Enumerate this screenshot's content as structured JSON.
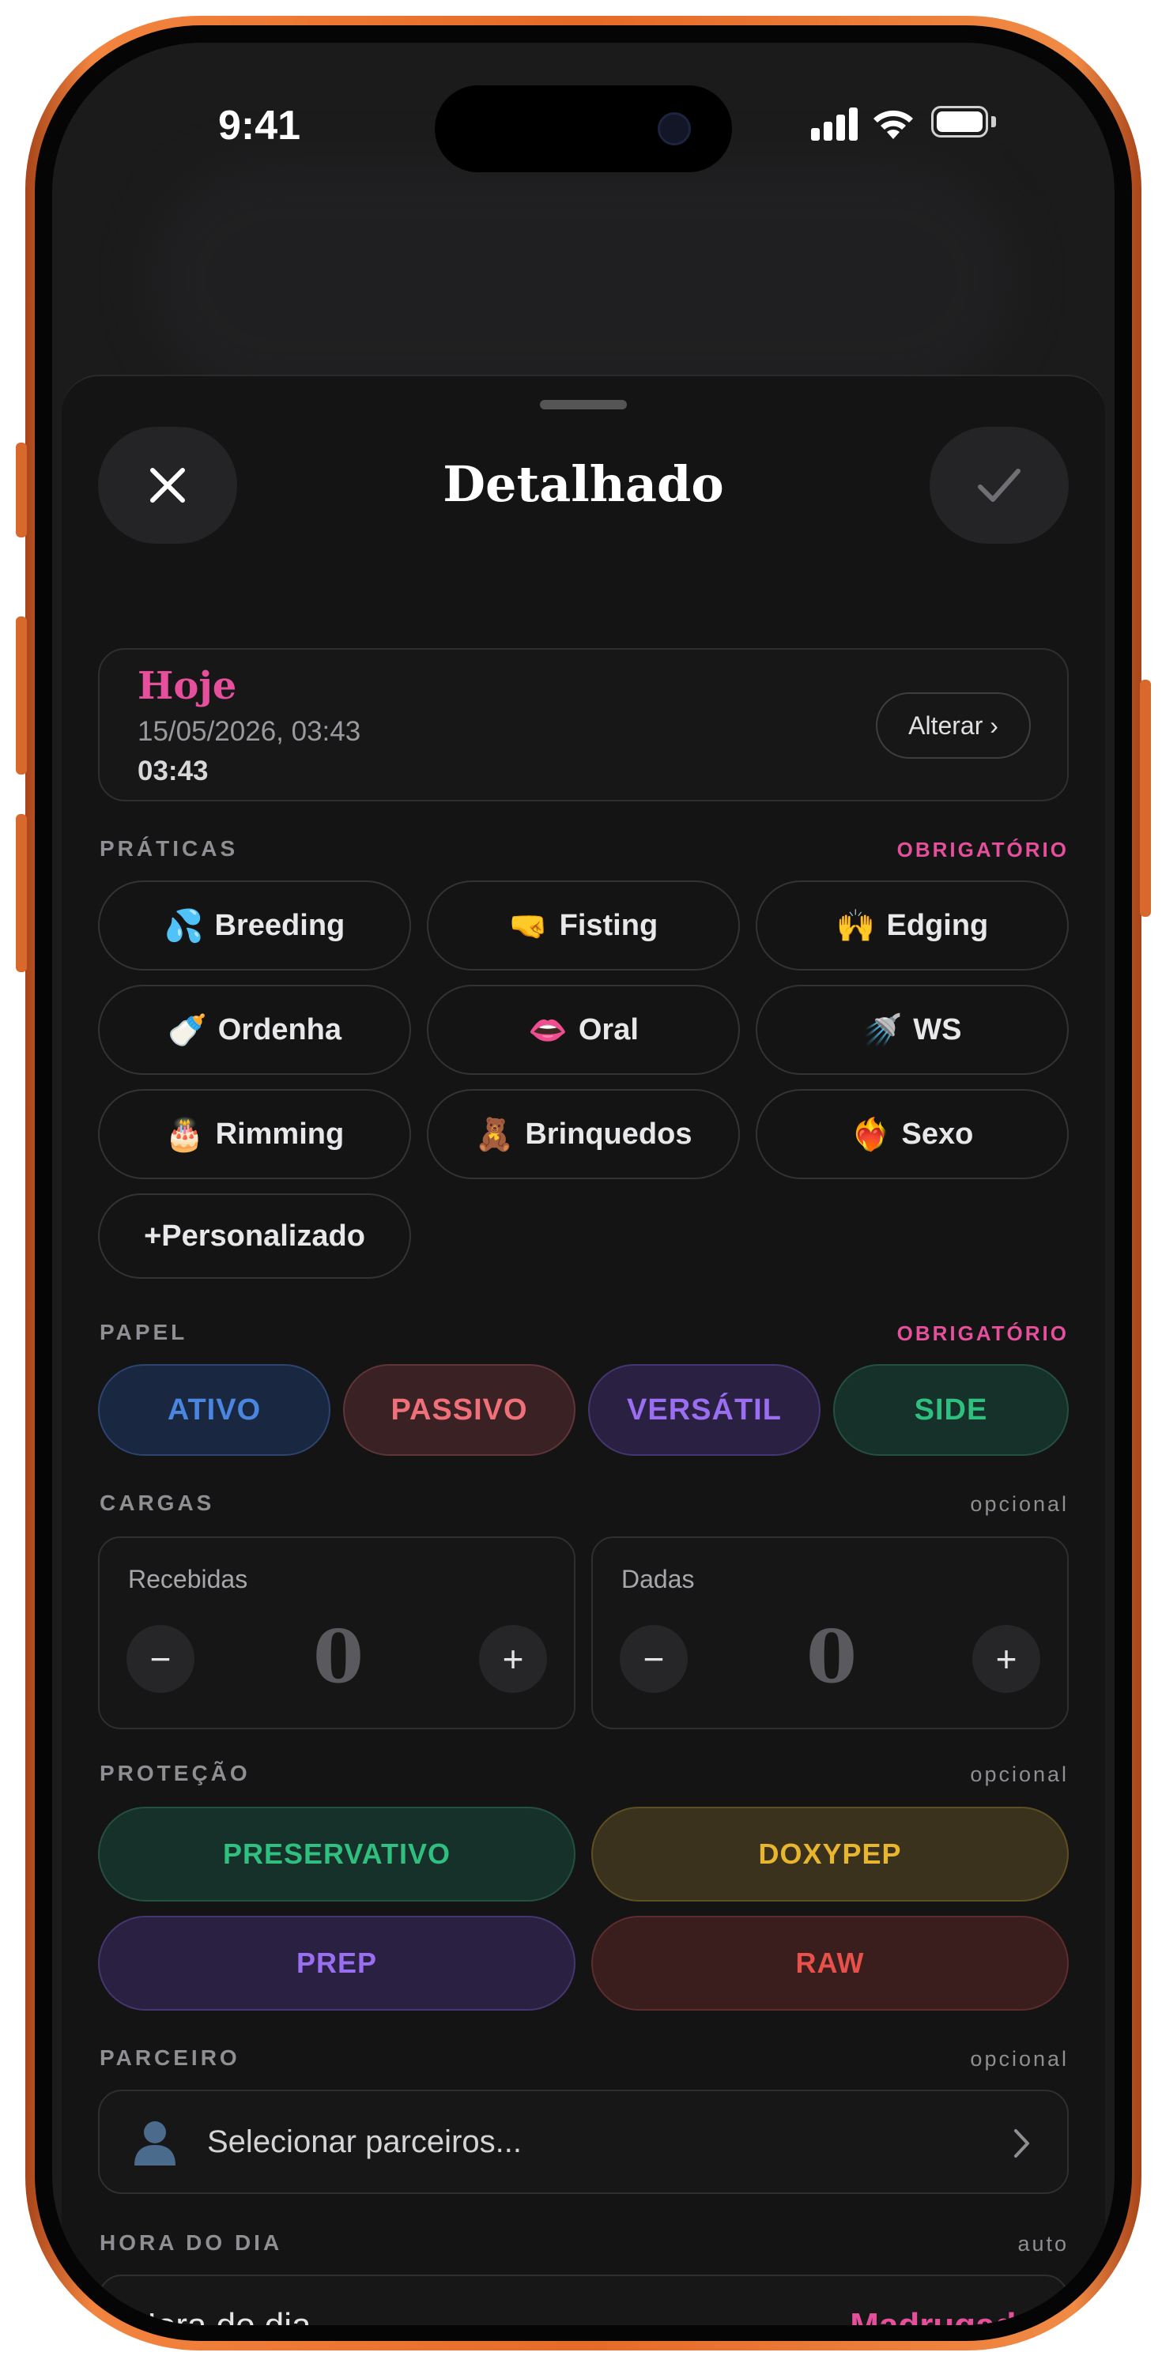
{
  "status_bar": {
    "time": "9:41"
  },
  "header": {
    "title": "Detalhado"
  },
  "date_card": {
    "relative_label": "Hoje",
    "date_line": "15/05/2026, 03:43",
    "time_line": "03:43",
    "change_button": "Alterar ›"
  },
  "practices": {
    "label": "PRÁTICAS",
    "requirement": "OBRIGATÓRIO",
    "items": [
      {
        "emoji": "💦",
        "label": "Breeding"
      },
      {
        "emoji": "🤜",
        "label": "Fisting"
      },
      {
        "emoji": "🙌",
        "label": "Edging"
      },
      {
        "emoji": "🍼",
        "label": "Ordenha"
      },
      {
        "emoji": "👄",
        "label": "Oral"
      },
      {
        "emoji": "🚿",
        "label": "WS"
      },
      {
        "emoji": "🎂",
        "label": "Rimming"
      },
      {
        "emoji": "🧸",
        "label": "Brinquedos"
      },
      {
        "emoji": "❤️‍🔥",
        "label": "Sexo"
      }
    ],
    "custom_button": "+Personalizado"
  },
  "role": {
    "label": "PAPEL",
    "requirement": "OBRIGATÓRIO",
    "options": [
      "ATIVO",
      "PASSIVO",
      "VERSÁTIL",
      "SIDE"
    ],
    "colors": {
      "ativo": "#4a86e0",
      "passivo": "#f0707a",
      "versatil": "#9a6ef0",
      "side": "#2fbf7f"
    }
  },
  "loads": {
    "label": "CARGAS",
    "requirement": "opcional",
    "received": {
      "label": "Recebidas",
      "value": "0",
      "minus": "−",
      "plus": "+"
    },
    "given": {
      "label": "Dadas",
      "value": "0",
      "minus": "−",
      "plus": "+"
    }
  },
  "protection": {
    "label": "PROTEÇÃO",
    "requirement": "opcional",
    "options": [
      "PRESERVATIVO",
      "DOXYPEP",
      "PREP",
      "RAW"
    ],
    "colors": {
      "preservativo": "#2fbf7f",
      "doxypep": "#e8b52e",
      "prep": "#9a6ef0",
      "raw": "#e8504a"
    }
  },
  "partner": {
    "label": "PARCEIRO",
    "requirement": "opcional",
    "placeholder": "Selecionar parceiros...",
    "icon": "person-silhouette-icon"
  },
  "time_of_day": {
    "label": "HORA DO DIA",
    "requirement": "auto",
    "row_label": "Hora do dia",
    "value": "Madrugada"
  },
  "accent": "#e64f9b"
}
